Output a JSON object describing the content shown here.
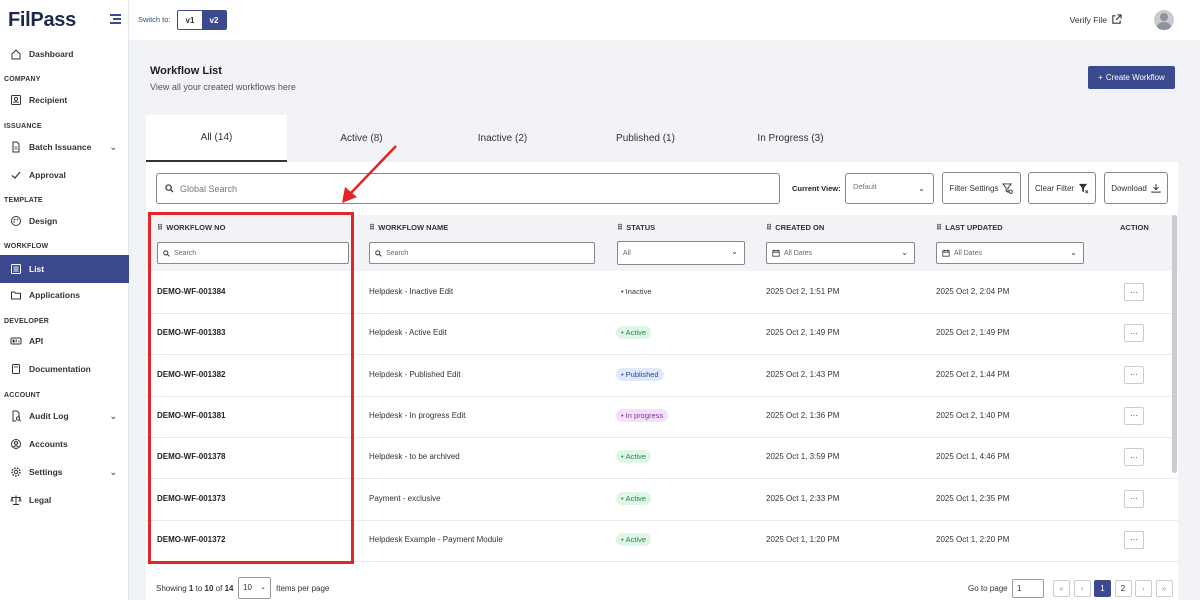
{
  "app": {
    "logo": "FilPass"
  },
  "sidebar": {
    "items": [
      {
        "type": "item",
        "label": "Dashboard",
        "icon": "home-icon"
      },
      {
        "type": "section",
        "label": "COMPANY"
      },
      {
        "type": "item",
        "label": "Recipient",
        "icon": "user-icon"
      },
      {
        "type": "section",
        "label": "ISSUANCE"
      },
      {
        "type": "item",
        "label": "Batch Issuance",
        "icon": "document-icon",
        "chevron": "⌄"
      },
      {
        "type": "item",
        "label": "Approval",
        "icon": "check-icon"
      },
      {
        "type": "section",
        "label": "TEMPLATE"
      },
      {
        "type": "item",
        "label": "Design",
        "icon": "palette-icon"
      },
      {
        "type": "section",
        "label": "WORKFLOW"
      },
      {
        "type": "item",
        "label": "List",
        "icon": "list-icon",
        "active": true
      },
      {
        "type": "item",
        "label": "Applications",
        "icon": "folder-icon"
      },
      {
        "type": "section",
        "label": "DEVELOPER"
      },
      {
        "type": "item",
        "label": "API",
        "icon": "api-icon"
      },
      {
        "type": "item",
        "label": "Documentation",
        "icon": "book-icon"
      },
      {
        "type": "section",
        "label": "ACCOUNT"
      },
      {
        "type": "item",
        "label": "Audit Log",
        "icon": "audit-icon",
        "chevron": "⌄"
      },
      {
        "type": "item",
        "label": "Accounts",
        "icon": "account-icon"
      },
      {
        "type": "item",
        "label": "Settings",
        "icon": "gear-icon",
        "chevron": "⌄"
      },
      {
        "type": "item",
        "label": "Legal",
        "icon": "scale-icon"
      }
    ]
  },
  "topbar": {
    "switch_label": "Switch to:",
    "v1": "v1",
    "v2": "v2",
    "verify": "Verify File"
  },
  "header": {
    "title": "Workflow List",
    "subtitle": "View all your created workflows here",
    "create_label": "Create Workflow"
  },
  "tabs": [
    {
      "label": "All (14)",
      "active": true
    },
    {
      "label": "Active (8)"
    },
    {
      "label": "Inactive (2)"
    },
    {
      "label": "Published (1)"
    },
    {
      "label": "In Progress (3)"
    }
  ],
  "toolbar": {
    "search_placeholder": "Global Search",
    "current_view_label": "Current View:",
    "current_view_value": "Default",
    "filter_settings": "Filter Settings",
    "clear_filter": "Clear Filter",
    "download": "Download"
  },
  "table": {
    "columns": {
      "workflow_no": "WORKFLOW NO",
      "workflow_name": "WORKFLOW NAME",
      "status": "STATUS",
      "created_on": "CREATED ON",
      "last_updated": "LAST UPDATED",
      "action": "ACTION"
    },
    "filters": {
      "workflow_no": "Search",
      "workflow_name": "Search",
      "status": "All",
      "created_on": "All Dates",
      "last_updated": "All Dates"
    },
    "rows": [
      {
        "no": "DEMO-WF-001384",
        "name": "Helpdesk - Inactive Edit",
        "status": "Inactive",
        "created": "2025 Oct 2, 1:51 PM",
        "updated": "2025 Oct 2, 2:04 PM"
      },
      {
        "no": "DEMO-WF-001383",
        "name": "Helpdesk - Active Edit",
        "status": "Active",
        "created": "2025 Oct 2, 1:49 PM",
        "updated": "2025 Oct 2, 1:49 PM"
      },
      {
        "no": "DEMO-WF-001382",
        "name": "Helpdesk - Published Edit",
        "status": "Published",
        "created": "2025 Oct 2, 1:43 PM",
        "updated": "2025 Oct 2, 1:44 PM"
      },
      {
        "no": "DEMO-WF-001381",
        "name": "Helpdesk - In progress Edit",
        "status": "In progress",
        "created": "2025 Oct 2, 1:36 PM",
        "updated": "2025 Oct 2, 1:40 PM"
      },
      {
        "no": "DEMO-WF-001378",
        "name": "Helpdesk - to be archived",
        "status": "Active",
        "created": "2025 Oct 1, 3:59 PM",
        "updated": "2025 Oct 1, 4:46 PM"
      },
      {
        "no": "DEMO-WF-001373",
        "name": "Payment - exclusive",
        "status": "Active",
        "created": "2025 Oct 1, 2:33 PM",
        "updated": "2025 Oct 1, 2:35 PM"
      },
      {
        "no": "DEMO-WF-001372",
        "name": "Helpdesk Example - Payment Module",
        "status": "Active",
        "created": "2025 Oct 1, 1:20 PM",
        "updated": "2025 Oct 1, 2:20 PM"
      }
    ],
    "action_label": "···"
  },
  "status_colors": {
    "Inactive": {
      "bg": "#ffffff",
      "fg": "#333333"
    },
    "Active": {
      "bg": "#dff5e6",
      "fg": "#1f8a4c"
    },
    "Published": {
      "bg": "#e0e8fb",
      "fg": "#2c4a9a"
    },
    "In progress": {
      "bg": "#f1e2f8",
      "fg": "#8a2fa8"
    }
  },
  "footer": {
    "showing_prefix": "Showing",
    "from": "1",
    "to_word": "to",
    "to": "10",
    "of_word": "of",
    "total": "14",
    "per_page_value": "10",
    "per_page_label": "Items per page",
    "goto_label": "Go to page",
    "goto_value": "1",
    "pages": [
      "«",
      "‹",
      "1",
      "2",
      "›",
      "»"
    ]
  },
  "colors": {
    "brand": "#3b4a8f",
    "annotation": "#e0252b"
  }
}
